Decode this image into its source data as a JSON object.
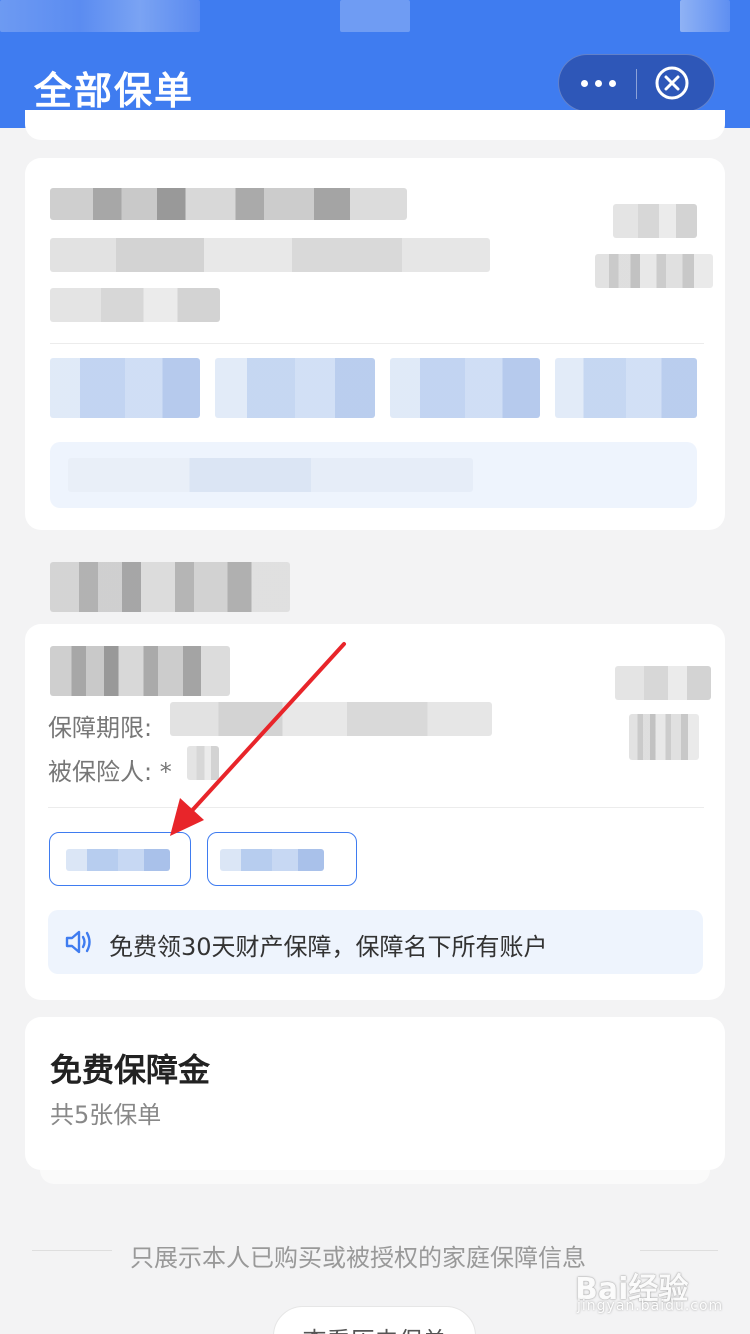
{
  "header": {
    "title": "全部保单"
  },
  "capsule": {
    "more_icon": "more-dots-icon",
    "close_icon": "close-circle-icon"
  },
  "policy_card": {
    "period_label": "保障期限:",
    "insured_label": "被保险人: *",
    "notice_icon": "speaker-icon",
    "notice_text": "免费领30天财产保障，保障名下所有账户"
  },
  "free_section": {
    "title": "免费保障金",
    "subtitle": "共5张保单"
  },
  "footer": {
    "info_text": "只展示本人已购买或被授权的家庭保障信息",
    "history_button": "查看历史保单"
  },
  "watermark": {
    "logo": "Bai经验",
    "url": "jingyan.baidu.com"
  },
  "colors": {
    "brand_blue": "#3f7cf0",
    "annotation_arrow": "#e8252a"
  }
}
